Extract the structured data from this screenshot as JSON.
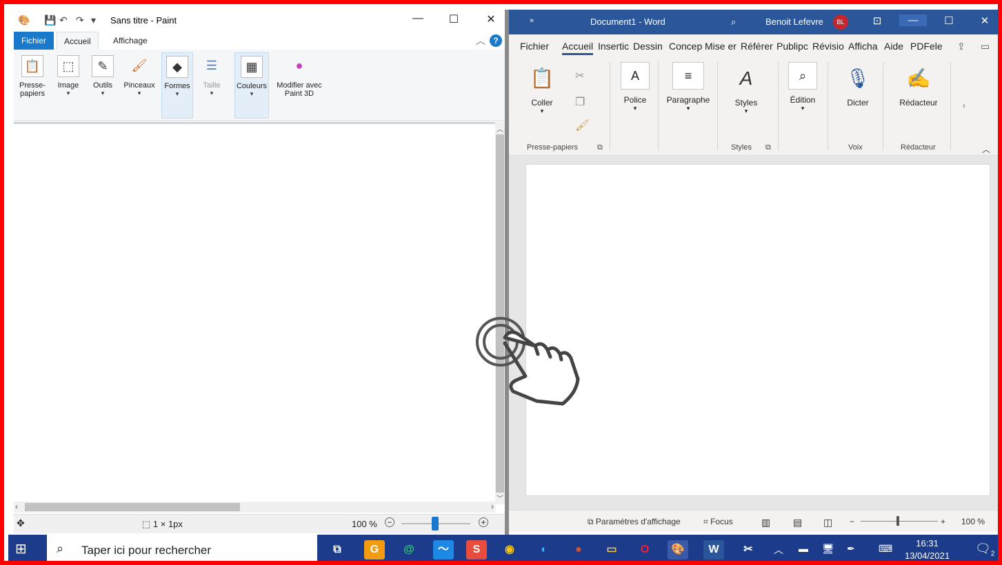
{
  "paint": {
    "title": "Sans titre - Paint",
    "quick_access": [
      "save-icon",
      "undo-icon",
      "redo-icon",
      "customize-icon"
    ],
    "tabs": {
      "file": "Fichier",
      "home": "Accueil",
      "view": "Affichage"
    },
    "help": "?",
    "groups": [
      {
        "label": "Presse-papiers",
        "icon": "clipboard-icon"
      },
      {
        "label": "Image",
        "icon": "select-icon"
      },
      {
        "label": "Outils",
        "icon": "tools-icon"
      },
      {
        "label": "Pinceaux",
        "icon": "brush-icon"
      },
      {
        "label": "Formes",
        "icon": "shapes-icon"
      },
      {
        "label": "Taille",
        "icon": "size-icon"
      },
      {
        "label": "Couleurs",
        "icon": "colors-icon"
      },
      {
        "label": "Modifier avec Paint 3D",
        "icon": "paint3d-icon"
      }
    ],
    "status": {
      "size": "1 × 1px",
      "zoom": "100 %",
      "zoom_level": 0.5
    }
  },
  "word": {
    "title": "Document1 - Word",
    "user": "Benoit Lefevre",
    "initials": "BL",
    "tabs": [
      "Fichier",
      "Accueil",
      "Insertic",
      "Dessin",
      "Concep",
      "Mise er",
      "Référer",
      "Publipc",
      "Révisio",
      "Afficha",
      "Aide",
      "PDFele"
    ],
    "ribbon": {
      "paste": "Coller",
      "font": "Police",
      "paragraph": "Paragraphe",
      "styles": "Styles",
      "editing": "Édition",
      "dictate": "Dicter",
      "editor": "Rédacteur",
      "groups": {
        "clipboard": "Presse-papiers",
        "styles": "Styles",
        "voice": "Voix",
        "editor": "Rédacteur"
      }
    },
    "status": {
      "display_settings": "Paramètres d'affichage",
      "focus": "Focus",
      "zoom": "100 %",
      "zoom_level": 0.5
    }
  },
  "taskbar": {
    "search_placeholder": "Taper ici pour rechercher",
    "time": "16:31",
    "date": "13/04/2021",
    "notifications": "2"
  }
}
